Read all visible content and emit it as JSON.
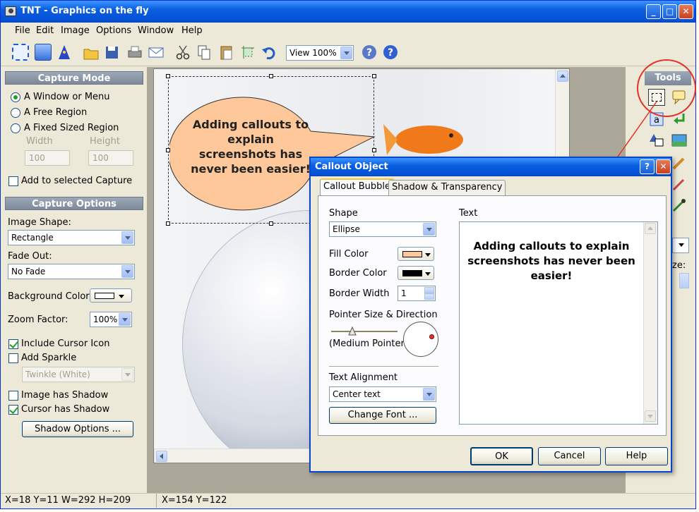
{
  "window": {
    "title": "TNT - Graphics on the fly"
  },
  "menu": [
    "File",
    "Edit",
    "Image",
    "Options",
    "Window",
    "Help"
  ],
  "toolbar": {
    "zoom": "View 100%"
  },
  "capture_mode": {
    "header": "Capture Mode",
    "options": [
      "A Window or Menu",
      "A Free Region",
      "A Fixed Sized Region"
    ],
    "selected": 0,
    "width_label": "Width",
    "height_label": "Height",
    "width_value": "100",
    "height_value": "100",
    "add_to_selected": "Add to selected Capture"
  },
  "capture_options": {
    "header": "Capture Options",
    "image_shape_label": "Image Shape:",
    "image_shape": "Rectangle",
    "fade_out_label": "Fade Out:",
    "fade_out": "No Fade",
    "background_color_label": "Background Color:",
    "zoom_factor_label": "Zoom Factor:",
    "zoom_factor": "100%",
    "include_cursor_icon": "Include Cursor Icon",
    "add_sparkle": "Add Sparkle",
    "sparkle_option": "Twinkle (White)",
    "image_has_shadow": "Image has Shadow",
    "cursor_has_shadow": "Cursor has Shadow",
    "shadow_options_button": "Shadow Options ..."
  },
  "canvas": {
    "callout_text": "Adding callouts to explain screenshots has never been easier!"
  },
  "tools": {
    "header": "Tools",
    "partial_label": "ze:"
  },
  "status": {
    "selection": "X=18 Y=11 W=292 H=209",
    "cursor": "X=154  Y=122"
  },
  "dialog": {
    "title": "Callout Object",
    "help_glyph": "?",
    "tabs": [
      "Callout Bubble",
      "Shadow & Transparency"
    ],
    "shape_label": "Shape",
    "shape": "Ellipse",
    "fill_color_label": "Fill Color",
    "border_color_label": "Border Color",
    "border_width_label": "Border Width",
    "border_width": "1",
    "pointer_label": "Pointer Size & Direction",
    "pointer_size": "(Medium Pointer)",
    "text_alignment_label": "Text Alignment",
    "text_alignment": "Center text",
    "change_font_button": "Change Font ...",
    "text_label": "Text",
    "text": "Adding callouts to explain screenshots has never been easier!",
    "ok": "OK",
    "cancel": "Cancel",
    "help": "Help"
  },
  "colors": {
    "fill": "#ffc89a",
    "border": "#000000",
    "accent": "#0a5fe0",
    "annotation": "#e3322a"
  }
}
